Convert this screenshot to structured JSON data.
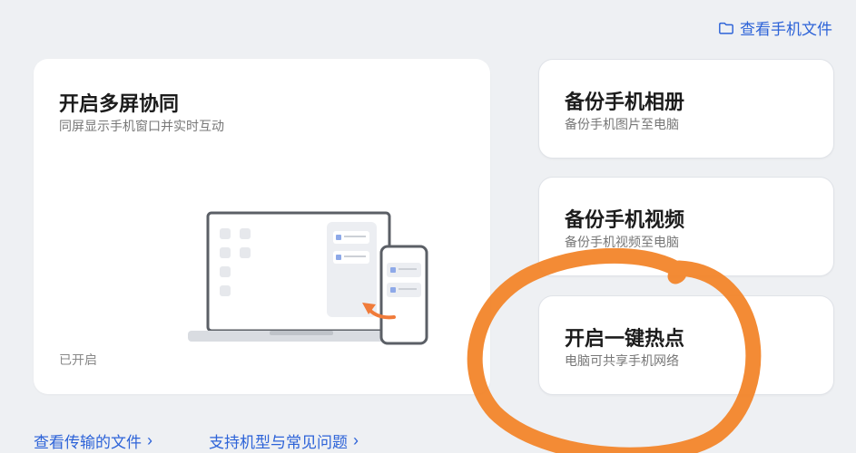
{
  "header": {
    "view_files_label": "查看手机文件"
  },
  "cards": {
    "multi_screen": {
      "title": "开启多屏协同",
      "subtitle": "同屏显示手机窗口并实时互动",
      "status": "已开启"
    },
    "backup_photos": {
      "title": "备份手机相册",
      "subtitle": "备份手机图片至电脑"
    },
    "backup_videos": {
      "title": "备份手机视频",
      "subtitle": "备份手机视频至电脑"
    },
    "hotspot": {
      "title": "开启一键热点",
      "subtitle": "电脑可共享手机网络"
    }
  },
  "footer": {
    "transfer_files_label": "查看传输的文件",
    "supported_models_label": "支持机型与常见问题",
    "chevron": "›"
  },
  "colors": {
    "accent": "#2d63d8",
    "annotation": "#f2852a",
    "background": "#eef0f3"
  },
  "icons": {
    "folder": "folder-icon",
    "transfer": "phone-to-laptop-illustration"
  }
}
